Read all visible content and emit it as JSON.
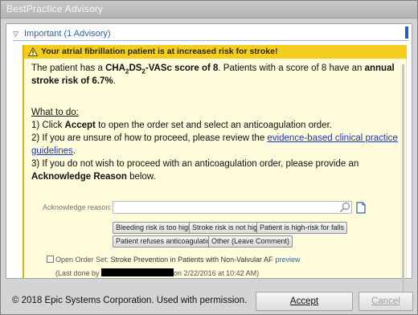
{
  "window": {
    "title": "BestPractice Advisory",
    "title_suffix": "-"
  },
  "section": {
    "label": "Important (1 Advisory)"
  },
  "advisory": {
    "header": "Your atrial fibrillation patient is at increased risk for stroke!",
    "score_intro": "The patient has a ",
    "score_cha": "CHA",
    "score_sub1": "2",
    "score_ds": "DS",
    "score_sub2": "2",
    "score_vasc": "-VASc score of 8",
    "score_mid": ".  Patients with a score of 8 have an ",
    "score_risk": "annual stroke risk of 6.7%",
    "score_end": ".",
    "what_to_do": "What to do:",
    "step1_pre": "1) Click ",
    "step1_bold": "Accept",
    "step1_post": " to open the order set and select an anticoagulation order.",
    "step2_pre": "2) If you are unsure of how to proceed, please review the ",
    "step2_link": "evidence-based clinical practice guidelines",
    "step2_post": ".",
    "step3_pre": "3) If you do not wish to proceed with an anticoagulation order, please provide an ",
    "step3_bold": "Acknowledge Reason",
    "step3_post": " below."
  },
  "acknowledge": {
    "label": "Acknowledge reason:",
    "value": "",
    "options": [
      "Bleeding risk is too high",
      "Stroke risk is not high",
      "Patient is high-risk for falls",
      "Patient refuses anticoagulation",
      "Other (Leave Comment)"
    ]
  },
  "order_set": {
    "prefix": "Open Order Set: ",
    "name": "Stroke Prevention in Patients with Non-Valvular AF",
    "preview": "preview",
    "last_done_pre": "(Last done by ",
    "last_done_post": "on 2/22/2016 at 10:42 AM)"
  },
  "footer": {
    "copyright": "© 2018 Epic Systems Corporation. Used with permission.",
    "accept_label": "Accept",
    "cancel_label": "Cancel"
  },
  "colors": {
    "advisory_header": "#f5cd1f",
    "advisory_bg": "#fffcdc",
    "link": "#1a37c9",
    "section_blue": "#2e5fb3"
  }
}
